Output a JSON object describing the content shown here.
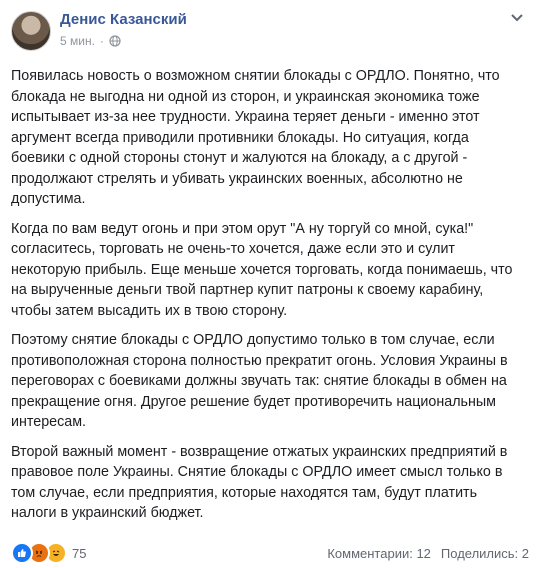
{
  "post": {
    "author": "Денис Казанский",
    "time": "5 мин.",
    "separator": "·",
    "paragraphs": [
      "Появилась новость о возможном снятии блокады с ОРДЛО. Понятно, что блокада не выгодна ни одной из сторон, и украинская экономика тоже испытывает из-за нее трудности. Украина теряет деньги - именно этот аргумент всегда приводили противники блокады. Но ситуация, когда боевики с одной стороны стонут и жалуются на блокаду, а с другой - продолжают стрелять и убивать украинских военных, абсолютно не допустима.",
      "Когда по вам ведут огонь и при этом орут \"А ну торгуй со мной, сука!\" согласитесь, торговать не очень-то хочется, даже если это и сулит некоторую прибыль. Еще меньше хочется торговать, когда понимаешь, что на вырученные деньги твой партнер купит патроны к своему карабину, чтобы затем высадить их в твою сторону.",
      "Поэтому снятие блокады с ОРДЛО допустимо только в том случае, если противоположная сторона полностью прекратит огонь. Условия Украины в переговорах с боевиками должны звучать так: снятие блокады в обмен на прекращение огня. Другое решение будет противоречить национальным интересам.",
      "Второй важный момент - возвращение отжатых украинских предприятий в правовое поле Украины. Снятие блокады с ОРДЛО имеет смысл только в том случае, если предприятия, которые находятся там, будут платить налоги в украинский бюджет."
    ]
  },
  "footer": {
    "reaction_count": "75",
    "comments": "Комментарии: 12",
    "shares": "Поделились: 2"
  },
  "colors": {
    "author": "#385898",
    "muted": "#90949c",
    "like": "#1877f2",
    "angry": "#e9710f",
    "haha": "#f7b125"
  },
  "icons": [
    "avatar",
    "globe-icon",
    "chevron-down-icon",
    "like-reaction-icon",
    "angry-reaction-icon",
    "haha-reaction-icon"
  ]
}
